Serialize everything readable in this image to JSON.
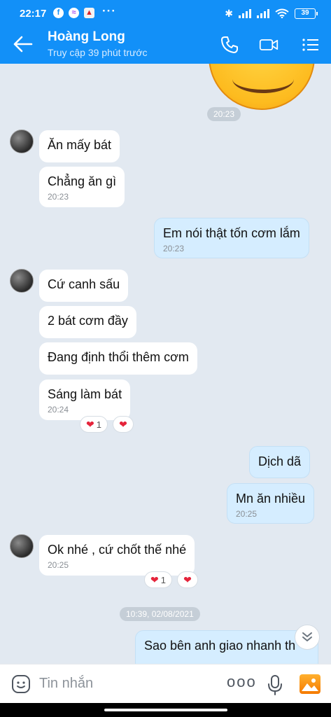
{
  "status_bar": {
    "time": "22:17",
    "app_icons": [
      "facebook-icon",
      "messenger-icon",
      "app-icon"
    ],
    "more": "···",
    "battery": "39"
  },
  "header": {
    "contact_name": "Hoàng Long",
    "contact_status": "Truy cập 39 phút trước",
    "accent": "#1290f8"
  },
  "messages": {
    "time_1": "20:23",
    "in_1": "Ăn mấy bát",
    "in_2": "Chẳng ăn gì",
    "in_2_ts": "20:23",
    "out_1": "Em nói thật tốn cơm lắm",
    "out_1_ts": "20:23",
    "in_3": "Cứ canh sấu",
    "in_4": "2 bát cơm đầy",
    "in_5": "Đang định thổi thêm cơm",
    "in_6": "Sáng làm bát",
    "in_6_ts": "20:24",
    "in_6_react_count": "1",
    "out_2": "Dịch dã",
    "out_3": "Mn ăn nhiều",
    "out_3_ts": "20:25",
    "in_7": "Ok nhé , cứ chốt thế nhé",
    "in_7_ts": "20:25",
    "in_7_react_count": "1",
    "time_2": "10:39, 02/08/2021",
    "out_4": "Sao bên anh giao nhanh th"
  },
  "input_bar": {
    "placeholder": "Tin nhắn",
    "more": "ooo"
  }
}
